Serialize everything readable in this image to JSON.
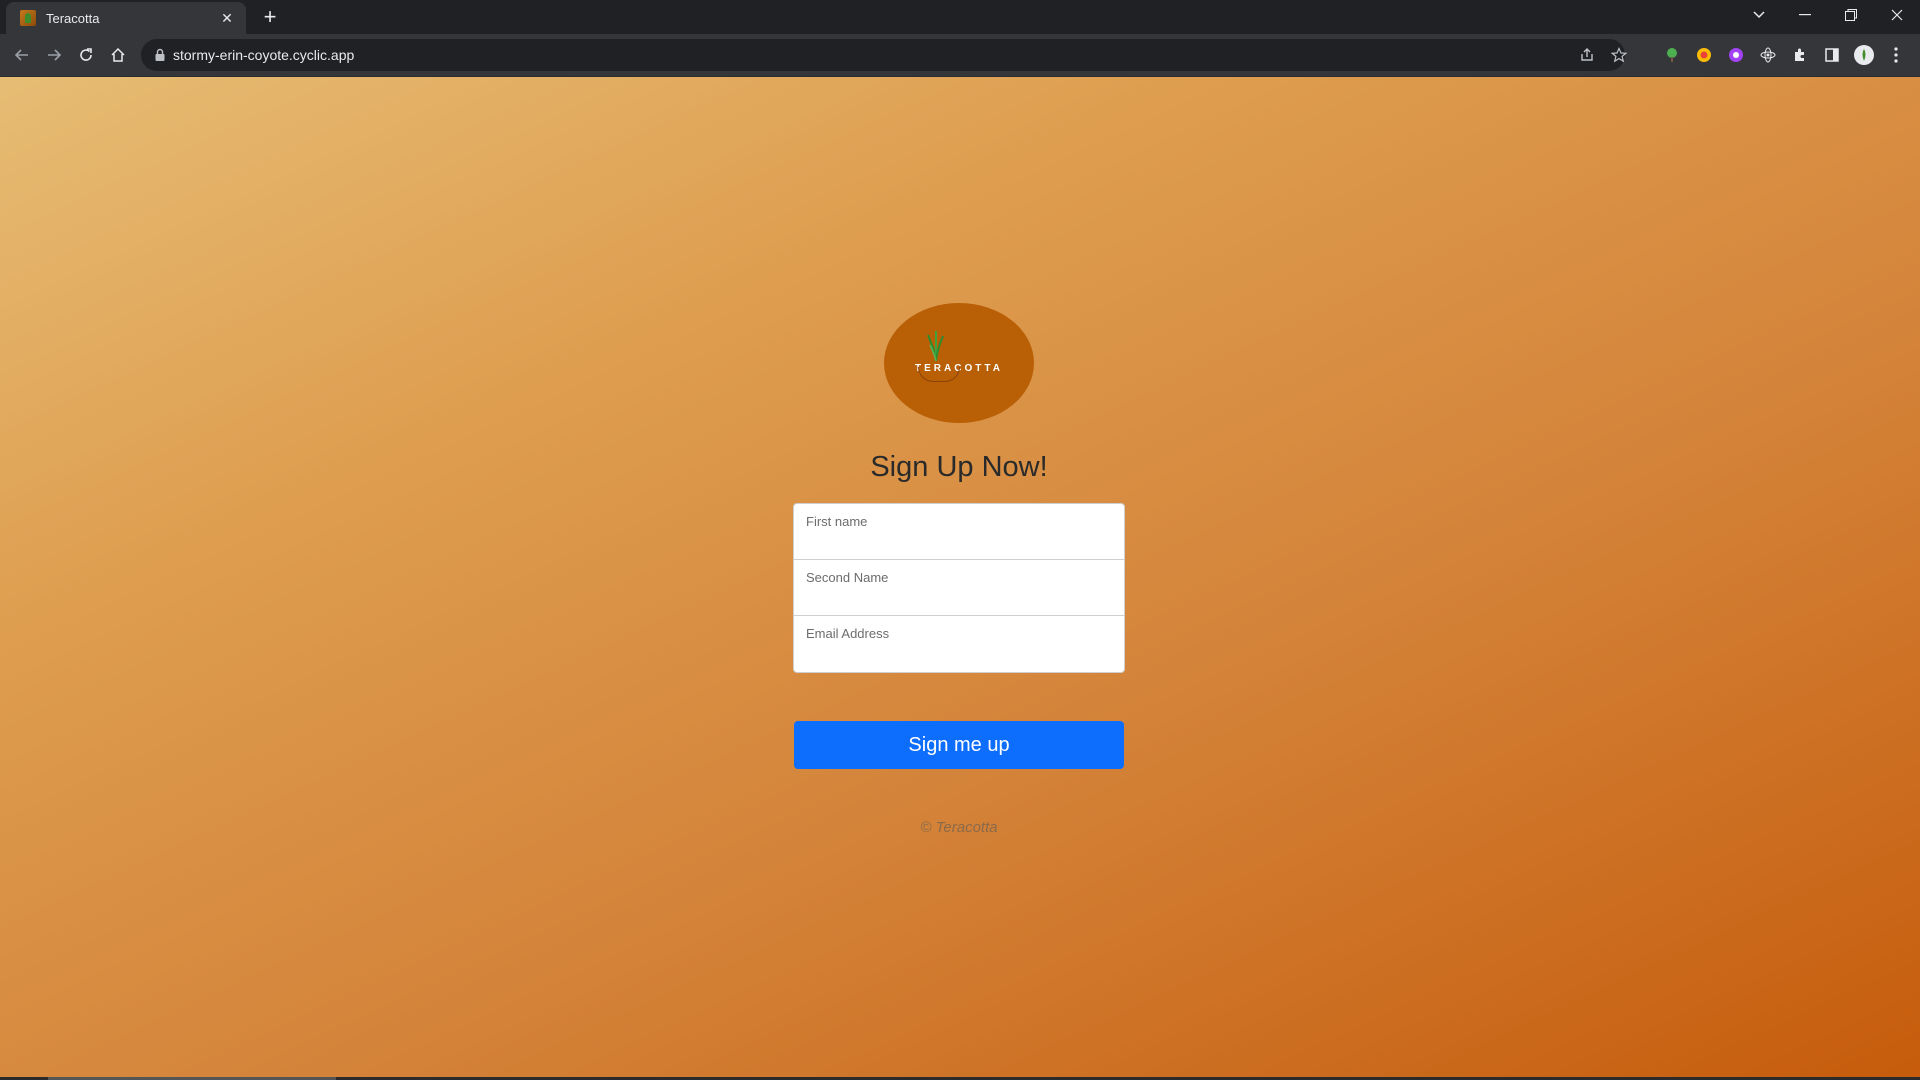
{
  "browser": {
    "tab": {
      "title": "Teracotta",
      "close_glyph": "✕"
    },
    "new_tab_glyph": "+",
    "address": {
      "url": "stormy-erin-coyote.cyclic.app"
    },
    "icons": [
      "back-icon",
      "forward-icon",
      "reload-icon",
      "home-icon",
      "lock-icon",
      "share-icon",
      "star-icon",
      "extensions-icon",
      "side-panel-icon",
      "profile-icon",
      "menu-icon"
    ]
  },
  "page": {
    "logo": {
      "text": "TERACOTTA"
    },
    "heading": "Sign Up Now!",
    "form": {
      "fields": [
        {
          "label": "First name"
        },
        {
          "label": "Second Name"
        },
        {
          "label": "Email Address"
        }
      ],
      "submit_label": "Sign me up"
    },
    "footer": "© Teracotta"
  },
  "colors": {
    "accent": "#0d6efd",
    "logo_bg": "#b95f06",
    "page_gradient_start": "#e6bc74",
    "page_gradient_end": "#c65c0c"
  }
}
